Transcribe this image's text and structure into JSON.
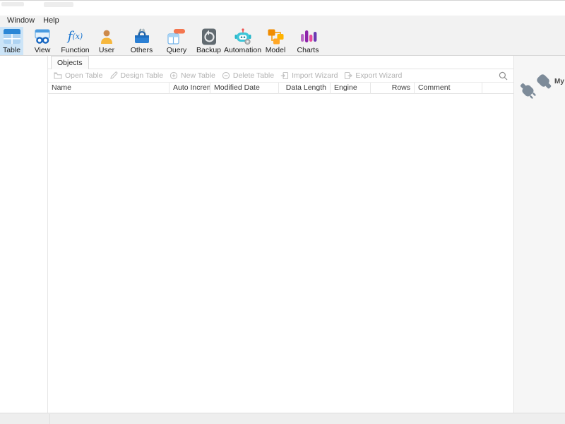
{
  "menubar": {
    "items": [
      {
        "label": "Window"
      },
      {
        "label": "Help"
      }
    ]
  },
  "toolbar": {
    "items": [
      {
        "label": "Table",
        "icon": "table-icon",
        "selected": true
      },
      {
        "label": "View",
        "icon": "view-icon",
        "selected": false
      },
      {
        "label": "Function",
        "icon": "function-icon",
        "selected": false
      },
      {
        "label": "User",
        "icon": "user-icon",
        "selected": false
      },
      {
        "label": "Others",
        "icon": "others-icon",
        "selected": false,
        "has_dropdown": true
      },
      {
        "label": "Query",
        "icon": "query-icon",
        "selected": false
      },
      {
        "label": "Backup",
        "icon": "backup-icon",
        "selected": false
      },
      {
        "label": "Automation",
        "icon": "automation-icon",
        "selected": false
      },
      {
        "label": "Model",
        "icon": "model-icon",
        "selected": false
      },
      {
        "label": "Charts",
        "icon": "charts-icon",
        "selected": false
      }
    ],
    "function_icon_text": "f(x)"
  },
  "tabs": [
    {
      "label": "Objects",
      "active": true
    }
  ],
  "object_toolbar": {
    "buttons": [
      {
        "label": "Open Table",
        "icon": "open-table-icon",
        "disabled": true
      },
      {
        "label": "Design Table",
        "icon": "design-table-icon",
        "disabled": true
      },
      {
        "label": "New Table",
        "icon": "new-table-icon",
        "disabled": true
      },
      {
        "label": "Delete Table",
        "icon": "delete-table-icon",
        "disabled": true
      },
      {
        "label": "Import Wizard",
        "icon": "import-wizard-icon",
        "disabled": true
      },
      {
        "label": "Export Wizard",
        "icon": "export-wizard-icon",
        "disabled": true
      }
    ]
  },
  "object_list": {
    "columns": [
      {
        "label": "Name",
        "align": "left"
      },
      {
        "label": "Auto Increm...",
        "align": "left"
      },
      {
        "label": "Modified Date",
        "align": "left"
      },
      {
        "label": "Data Length",
        "align": "right"
      },
      {
        "label": "Engine",
        "align": "left"
      },
      {
        "label": "Rows",
        "align": "right"
      },
      {
        "label": "Comment",
        "align": "left"
      }
    ],
    "rows": []
  },
  "connection_panel": {
    "label": "My"
  },
  "colors": {
    "selected_button_bg": "#cce4f7",
    "toolbar_bg": "#f2f2f2",
    "disabled_text": "#b3b3b3",
    "header_text": "#3c3c3c",
    "sidebar_bg": "#f6f6f6",
    "plug_icon": "#7d8b99"
  }
}
